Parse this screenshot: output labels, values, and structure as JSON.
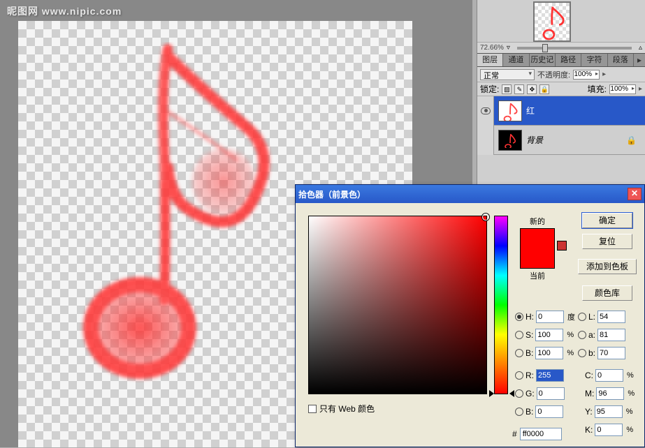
{
  "watermark": "昵图网 www.nipic.com",
  "navigator": {
    "zoom": "72.66%"
  },
  "panel_tabs": [
    "图层",
    "通道",
    "历史记",
    "路径",
    "字符",
    "段落"
  ],
  "layer_panel": {
    "blend_label": "正常",
    "opacity_label": "不透明度:",
    "opacity_value": "100%",
    "lock_label": "锁定:",
    "fill_label": "填充:",
    "fill_value": "100%",
    "layers": [
      {
        "name": "红",
        "selected": true,
        "visible": true
      },
      {
        "name": "背景",
        "selected": false,
        "visible": false,
        "locked": true
      }
    ]
  },
  "picker": {
    "title": "拾色器（前景色）",
    "new_label": "新的",
    "current_label": "当前",
    "buttons": {
      "ok": "确定",
      "reset": "复位",
      "add": "添加到色板",
      "lib": "颜色库"
    },
    "web_only": "只有 Web 颜色",
    "hsb": {
      "h_label": "H:",
      "h": "0",
      "h_unit": "度",
      "s_label": "S:",
      "s": "100",
      "s_unit": "%",
      "b_label": "B:",
      "b": "100",
      "b_unit": "%"
    },
    "lab": {
      "l_label": "L:",
      "l": "54",
      "a_label": "a:",
      "a": "81",
      "b_label": "b:",
      "b": "70"
    },
    "rgb": {
      "r_label": "R:",
      "r": "255",
      "g_label": "G:",
      "g": "0",
      "b_label": "B:",
      "b": "0"
    },
    "cmyk": {
      "c_label": "C:",
      "c": "0",
      "m_label": "M:",
      "m": "96",
      "y_label": "Y:",
      "y": "95",
      "k_label": "K:",
      "k": "0",
      "unit": "%"
    },
    "hex_label": "#",
    "hex": "ff0000",
    "swatch_color": "#ff0000"
  }
}
